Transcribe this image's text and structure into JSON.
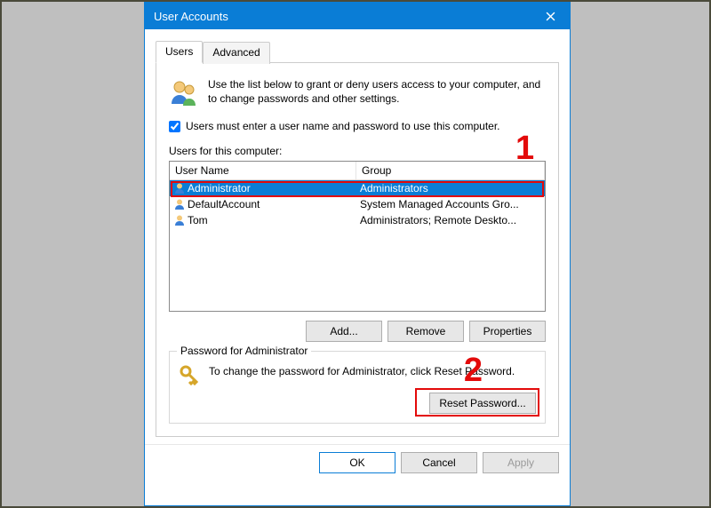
{
  "window": {
    "title": "User Accounts"
  },
  "tabs": {
    "users": "Users",
    "advanced": "Advanced"
  },
  "intro": "Use the list below to grant or deny users access to your computer, and to change passwords and other settings.",
  "checkbox_label": "Users must enter a user name and password to use this computer.",
  "list_label": "Users for this computer:",
  "columns": {
    "name": "User Name",
    "group": "Group"
  },
  "rows": [
    {
      "name": "Administrator",
      "group": "Administrators",
      "selected": true
    },
    {
      "name": "DefaultAccount",
      "group": "System Managed Accounts Gro...",
      "selected": false
    },
    {
      "name": "Tom",
      "group": "Administrators; Remote Deskto...",
      "selected": false
    }
  ],
  "buttons": {
    "add": "Add...",
    "remove": "Remove",
    "properties": "Properties"
  },
  "password_group": {
    "legend": "Password for Administrator",
    "text": "To change the password for Administrator, click Reset Password.",
    "reset": "Reset Password..."
  },
  "dialog_buttons": {
    "ok": "OK",
    "cancel": "Cancel",
    "apply": "Apply"
  },
  "annotations": {
    "one": "1",
    "two": "2"
  }
}
